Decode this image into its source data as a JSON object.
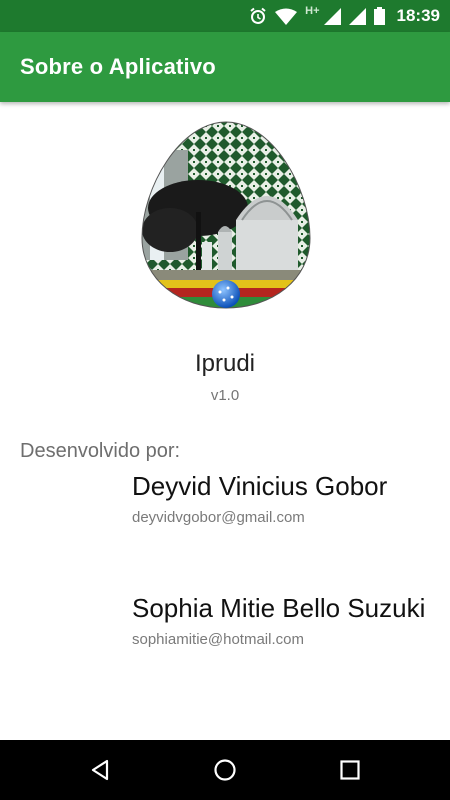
{
  "status_bar": {
    "time": "18:39",
    "network": "H+",
    "icons": [
      "alarm-icon",
      "wifi-icon",
      "signal-icon",
      "signal-icon",
      "battery-icon"
    ]
  },
  "app_bar": {
    "title": "Sobre o Aplicativo",
    "color": "#2e9a40"
  },
  "about": {
    "app_name": "Iprudi",
    "version": "v1.0",
    "developed_by_label": "Desenvolvido por:",
    "developers": [
      {
        "name": "Deyvid Vinicius Gobor",
        "email": "deyvidvgobor@gmail.com"
      },
      {
        "name": "Sophia Mitie Bello Suzuki",
        "email": "sophiamitie@hotmail.com"
      }
    ]
  },
  "nav_bar": {
    "icons": [
      "back-icon",
      "home-icon",
      "recent-apps-icon"
    ]
  }
}
